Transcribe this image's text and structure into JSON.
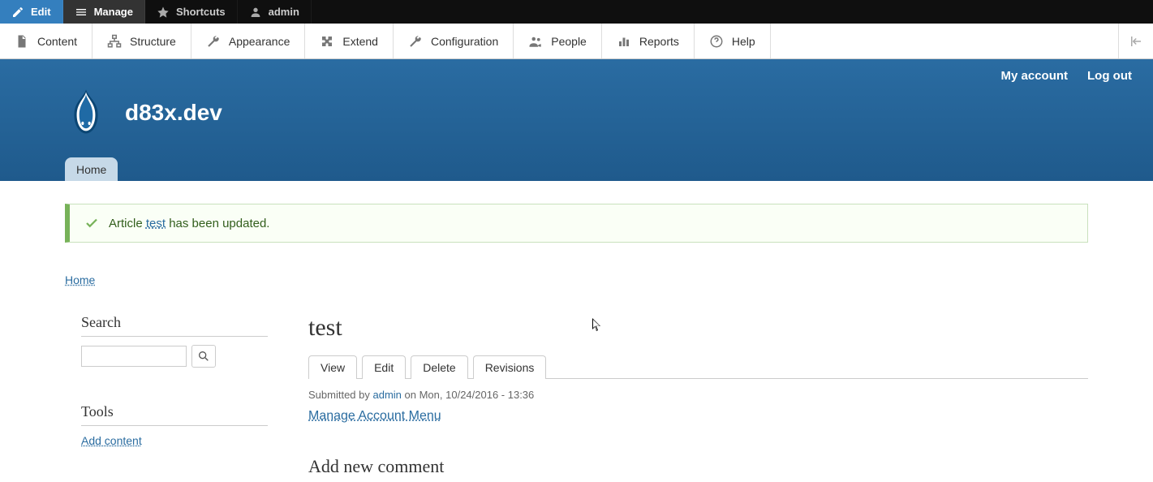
{
  "toolbar1": {
    "edit": "Edit",
    "manage": "Manage",
    "shortcuts": "Shortcuts",
    "admin": "admin"
  },
  "toolbar2": {
    "content": "Content",
    "structure": "Structure",
    "appearance": "Appearance",
    "extend": "Extend",
    "configuration": "Configuration",
    "people": "People",
    "reports": "Reports",
    "help": "Help"
  },
  "header": {
    "my_account": "My account",
    "log_out": "Log out",
    "site_name": "d83x.dev",
    "home_tab": "Home"
  },
  "status": {
    "prefix": "Article ",
    "link": "test",
    "suffix": " has been updated."
  },
  "breadcrumb": {
    "home": "Home"
  },
  "sidebar": {
    "search_heading": "Search",
    "tools_heading": "Tools",
    "add_content": "Add content"
  },
  "main": {
    "title": "test",
    "tabs": {
      "view": "View",
      "edit": "Edit",
      "delete": "Delete",
      "revisions": "Revisions"
    },
    "submitted_prefix": "Submitted by ",
    "submitted_author": "admin",
    "submitted_suffix": " on Mon, 10/24/2016 - 13:36",
    "body_link": "Manage Account Menu",
    "comment_heading": "Add new comment"
  }
}
